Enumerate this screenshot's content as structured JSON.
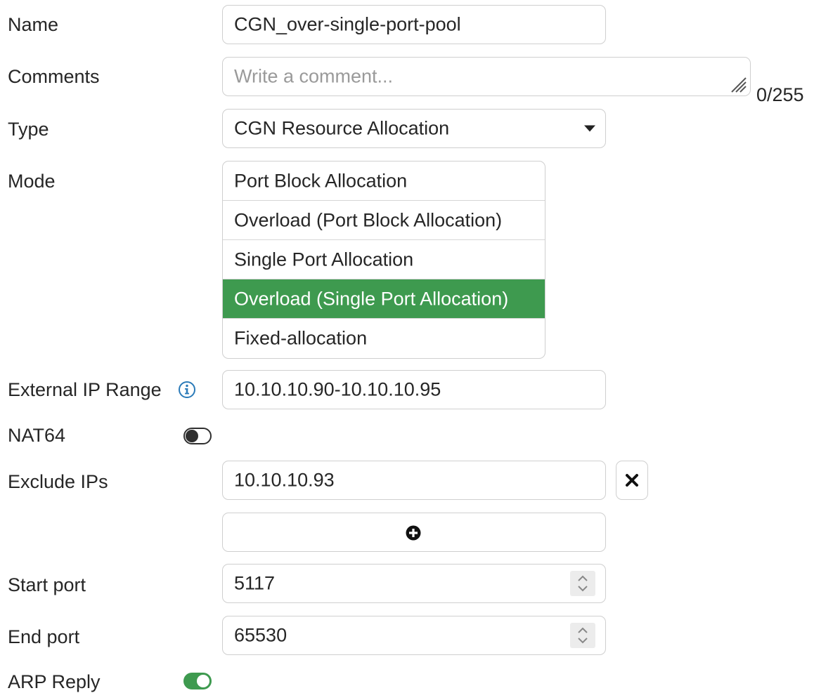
{
  "form": {
    "name": {
      "label": "Name",
      "value": "CGN_over-single-port-pool"
    },
    "comments": {
      "label": "Comments",
      "placeholder": "Write a comment...",
      "counter": "0/255"
    },
    "type": {
      "label": "Type",
      "value": "CGN Resource Allocation"
    },
    "mode": {
      "label": "Mode",
      "options": [
        "Port Block Allocation",
        "Overload (Port Block Allocation)",
        "Single Port Allocation",
        "Overload (Single Port Allocation)",
        "Fixed-allocation"
      ],
      "selected_index": 3
    },
    "external_ip_range": {
      "label": "External IP Range",
      "value": "10.10.10.90-10.10.10.95"
    },
    "nat64": {
      "label": "NAT64",
      "enabled": false
    },
    "exclude_ips": {
      "label": "Exclude IPs",
      "values": [
        "10.10.10.93"
      ]
    },
    "start_port": {
      "label": "Start port",
      "value": "5117"
    },
    "end_port": {
      "label": "End port",
      "value": "65530"
    },
    "arp_reply": {
      "label": "ARP Reply",
      "enabled": true
    }
  },
  "colors": {
    "accent": "#3e9a4f",
    "info": "#2a7ab8",
    "border": "#cfcfcf"
  },
  "icons": {
    "info": "info-icon",
    "remove": "close-icon",
    "add": "plus-circle-icon",
    "type_dropdown": "caret-down-icon",
    "spinner": "spinner-arrows-icon",
    "resize": "resize-grip-icon"
  }
}
